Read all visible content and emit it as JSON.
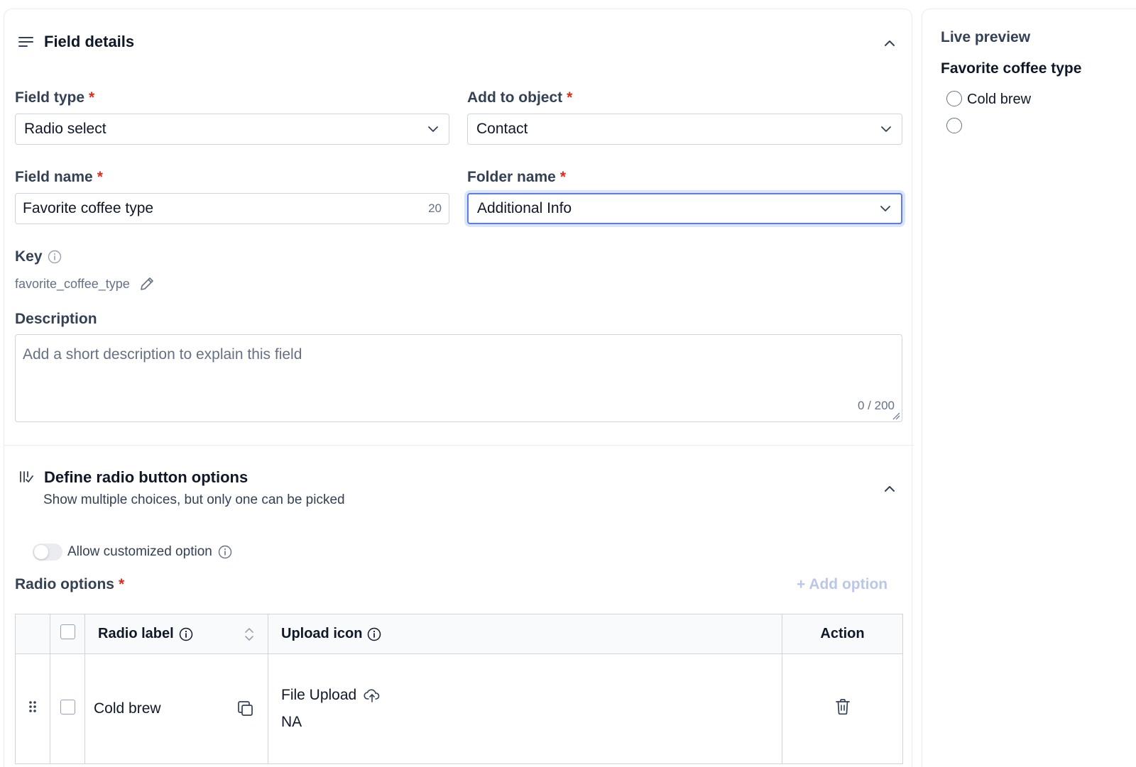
{
  "field_details": {
    "title": "Field details",
    "field_type": {
      "label": "Field type",
      "required_mark": "*",
      "value": "Radio select"
    },
    "add_to_object": {
      "label": "Add to object",
      "required_mark": "*",
      "value": "Contact"
    },
    "field_name": {
      "label": "Field name",
      "required_mark": "*",
      "value": "Favorite coffee type",
      "char_count": "20"
    },
    "folder_name": {
      "label": "Folder name",
      "required_mark": "*",
      "value": "Additional Info"
    },
    "key": {
      "label": "Key",
      "value": "favorite_coffee_type"
    },
    "description": {
      "label": "Description",
      "placeholder": "Add a short description to explain this field",
      "counter": "0 / 200"
    }
  },
  "radio_section": {
    "title": "Define radio button options",
    "subtitle": "Show multiple choices, but only one can be picked",
    "allow_custom_label": "Allow customized option",
    "allow_custom_enabled": false,
    "options_label": "Radio options",
    "required_mark": "*",
    "add_option_label": "+ Add option",
    "table": {
      "headers": {
        "radio_label": "Radio label",
        "upload_icon": "Upload icon",
        "action": "Action"
      },
      "rows": [
        {
          "label": "Cold brew",
          "upload_title": "File Upload",
          "upload_value": "NA"
        }
      ]
    }
  },
  "live_preview": {
    "title": "Live preview",
    "field_title": "Favorite coffee type",
    "options": [
      "Cold brew",
      ""
    ]
  },
  "colors": {
    "required": "#d92d20",
    "focus_border": "#5b7fe0",
    "add_option_disabled": "#bac7e9"
  },
  "icons": [
    "lines-icon",
    "chevron-up-icon",
    "chevron-down-icon",
    "info-icon",
    "pencil-icon",
    "resize-grip-icon",
    "radio-options-icon",
    "sort-icon",
    "drag-handle-icon",
    "copy-icon",
    "cloud-upload-icon",
    "trash-icon"
  ]
}
